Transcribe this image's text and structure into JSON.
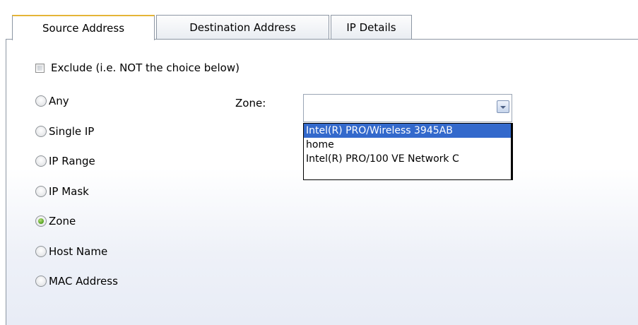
{
  "tabs": [
    {
      "label": "Source Address",
      "active": true
    },
    {
      "label": "Destination Address",
      "active": false
    },
    {
      "label": "IP Details",
      "active": false
    }
  ],
  "exclude": {
    "label": "Exclude (i.e. NOT the choice below)",
    "checked": false
  },
  "address_types": [
    {
      "label": "Any",
      "checked": false
    },
    {
      "label": "Single IP",
      "checked": false
    },
    {
      "label": "IP Range",
      "checked": false
    },
    {
      "label": "IP Mask",
      "checked": false
    },
    {
      "label": "Zone",
      "checked": true
    },
    {
      "label": "Host Name",
      "checked": false
    },
    {
      "label": "MAC Address",
      "checked": false
    }
  ],
  "zone": {
    "label": "Zone:",
    "value": "",
    "options": [
      {
        "label": "Intel(R) PRO/Wireless 3945AB",
        "highlighted": true
      },
      {
        "label": "home",
        "highlighted": false
      },
      {
        "label": "Intel(R) PRO/100 VE Network C",
        "highlighted": false
      }
    ]
  },
  "colors": {
    "active_tab_accent": "#e5b537",
    "selection": "#3369cc",
    "radio_checked": "#5fa82a"
  }
}
